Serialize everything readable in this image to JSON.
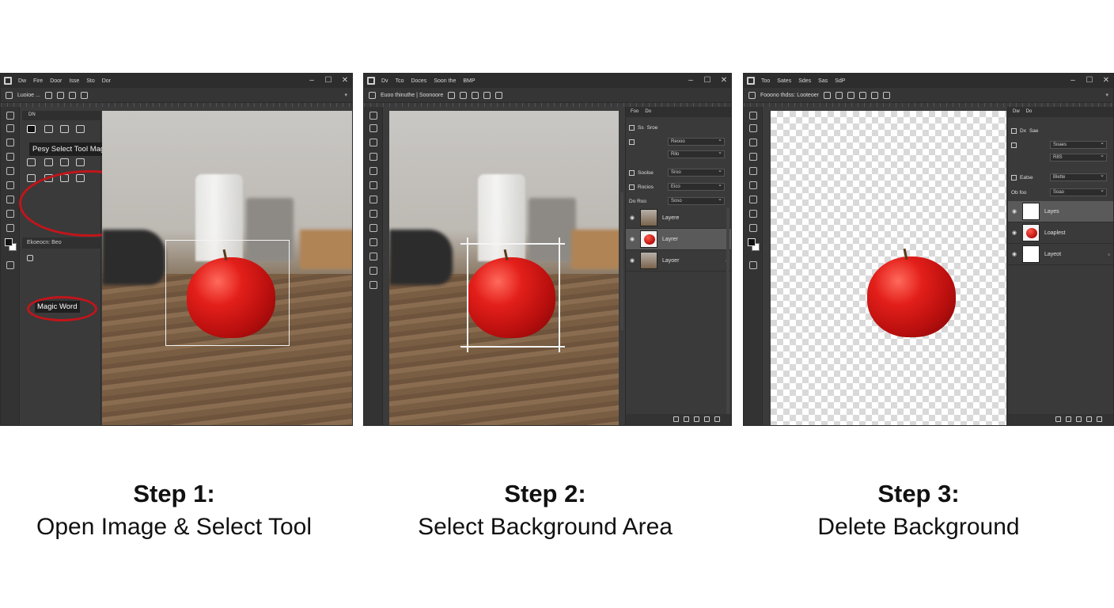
{
  "panels": [
    {
      "menu": [
        "Dw",
        "Fire",
        "Door",
        "Isse",
        "Sto",
        "Dor"
      ],
      "window_controls": [
        "–",
        "☐",
        "✕"
      ],
      "options_text": "Luoioe ...",
      "tools_tab": "DN",
      "tooltip": "Pesy Select Tool Magic Word",
      "section_header": "Ekoeocn: Beo",
      "magic_item": "Magic Word"
    },
    {
      "menu": [
        "Dv",
        "Tco",
        "Doces",
        "Soon the",
        "BMP"
      ],
      "window_controls": [
        "–",
        "☐",
        "✕"
      ],
      "options_text": "Euoo thinuthe | Soonoore",
      "panel_tabs": [
        "Foo",
        "Do"
      ],
      "props": [
        {
          "label": "Ss",
          "value": "Sroe"
        },
        {
          "label": "",
          "value": "Reooo",
          "dropdown": true
        },
        {
          "label": "",
          "value": "Rilo",
          "dropdown": true
        },
        {
          "label": "Soolse",
          "value": "Sroo",
          "dropdown": true
        },
        {
          "label": "Rocios",
          "value": "Eico",
          "dropdown": true
        },
        {
          "label": "Do Roo",
          "value": "Soso",
          "dropdown": true
        }
      ],
      "layers": [
        "Layere",
        "Layrer",
        "Layoer"
      ]
    },
    {
      "menu": [
        "Too",
        "Sates",
        "Sdes",
        "Sas",
        "SdP"
      ],
      "window_controls": [
        "–",
        "☐",
        "✕"
      ],
      "options_text": "Fooono thdss: Looteoer",
      "panel_tabs": [
        "Dw",
        "Do"
      ],
      "props": [
        {
          "label": "Dx",
          "value": "Sae"
        },
        {
          "label": "",
          "value": "Soaes",
          "dropdown": true
        },
        {
          "label": "",
          "value": "R8S",
          "dropdown": true
        },
        {
          "label": "Eatse",
          "value": "Blette",
          "dropdown": true
        },
        {
          "label": "Ob foo",
          "value": "Soao",
          "dropdown": true
        }
      ],
      "layers": [
        "Layes",
        "Loaplest",
        "Layeot"
      ]
    }
  ],
  "captions": [
    {
      "step": "Step 1:",
      "desc": "Open Image & Select Tool"
    },
    {
      "step": "Step 2:",
      "desc": "Select Background Area"
    },
    {
      "step": "Step 3:",
      "desc": "Delete Background"
    }
  ],
  "colors": {
    "window_bg": "#3b3b3b",
    "highlight_ring": "#c0151b",
    "apple": "#e31f1a"
  }
}
